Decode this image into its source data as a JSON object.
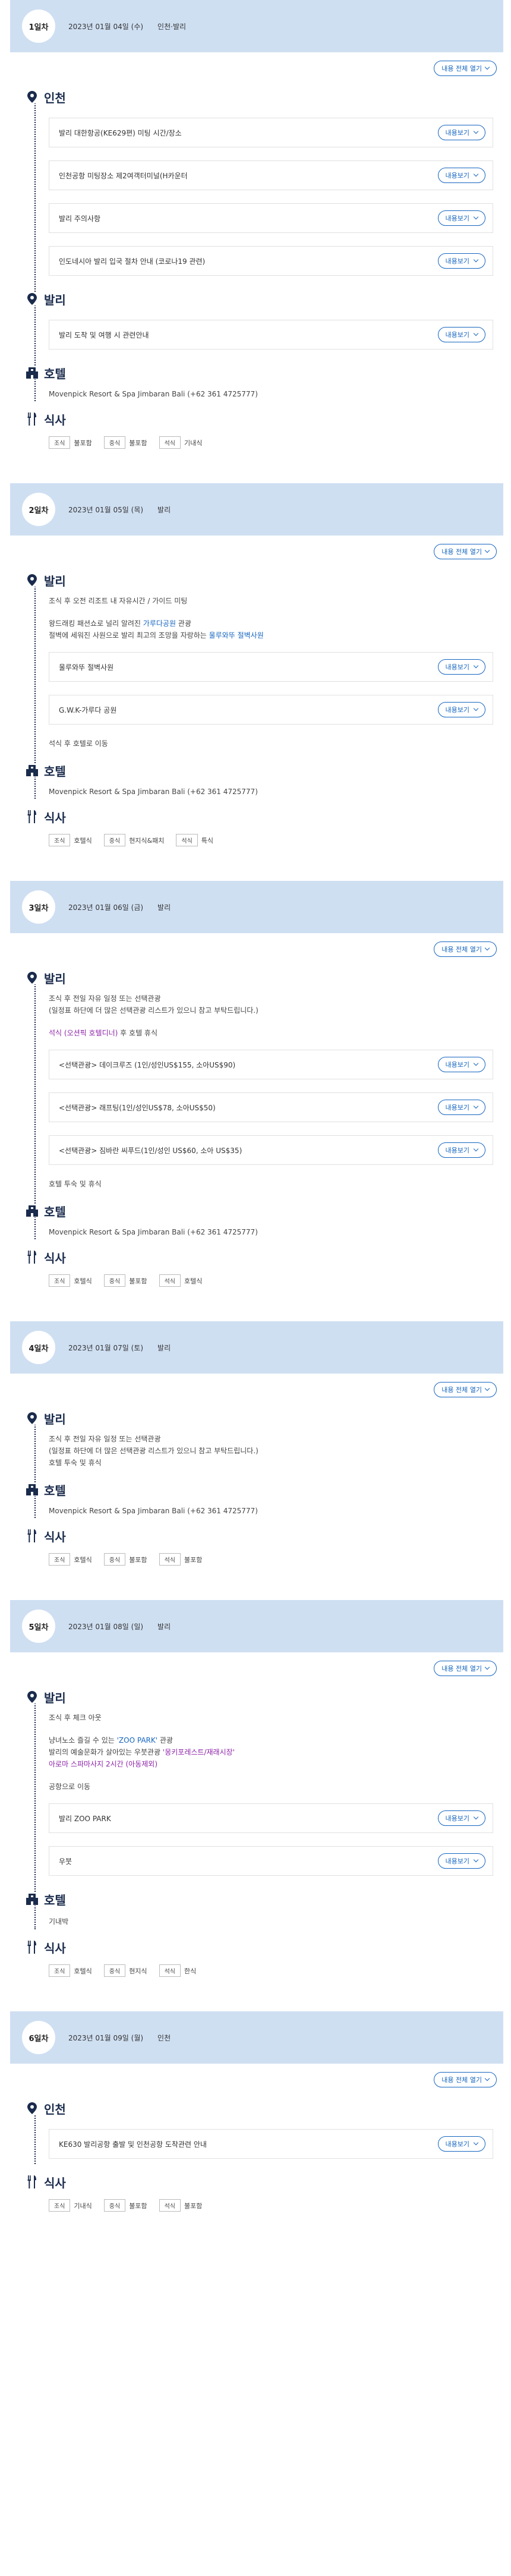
{
  "expand_all_label": "내용 전체 열기",
  "more_label": "내용보기",
  "days": [
    {
      "badge": "1일차",
      "date": "2023년 01월 04일 (수)",
      "place": "인천·발리",
      "incheon_title": "인천",
      "incheon_items": [
        "발리 대한항공(KE629편) 미팅 시간/장소",
        "인천공항 미팅장소 제2여객터미널(H카운터",
        "발리 주의사항",
        "인도네시아 발리 입국 절차 안내 (코로나19 관련)"
      ],
      "bali_title": "발리",
      "bali_items": [
        "발리 도착 및 여행 시 관련안내"
      ],
      "hotel_title": "호텔",
      "hotel": "Movenpick Resort & Spa Jimbaran Bali (+62 361 4725777)",
      "meal_title": "식사",
      "meals": [
        {
          "tag": "조식",
          "val": "불포함"
        },
        {
          "tag": "중식",
          "val": "불포함"
        },
        {
          "tag": "석식",
          "val": "기내식"
        }
      ]
    },
    {
      "badge": "2일차",
      "date": "2023년 01월 05일 (목)",
      "place": "발리",
      "bali_title": "발리",
      "text1": "조식 후 오전 리조트 내 자유시간 / 가이드 미팅",
      "text2a": "왕드래킹 패션쇼로 널리 알려진 ",
      "text2b": "가루다공원",
      "text2c": " 관광",
      "text3a": "절벽에 세워진 사원으로 발리 최고의 조망을 자랑하는 ",
      "text3b": "울루와뚜 절벽사원",
      "bali_items": [
        "울루와뚜 절벽사원",
        "G.W.K-가루다 공원"
      ],
      "text4": "석식 후 호텔로 이동",
      "hotel_title": "호텔",
      "hotel": "Movenpick Resort & Spa Jimbaran Bali (+62 361 4725777)",
      "meal_title": "식사",
      "meals": [
        {
          "tag": "조식",
          "val": "호텔식"
        },
        {
          "tag": "중식",
          "val": "현지식&패치"
        },
        {
          "tag": "석식",
          "val": "특식"
        }
      ]
    },
    {
      "badge": "3일차",
      "date": "2023년 01월 06일 (금)",
      "place": "발리",
      "bali_title": "발리",
      "text1": "조식 후 전일 자유 일정 또는 선택관광",
      "text2": "(일정표 하단에 더 많은 선택관광 리스트가 있으니 참고 부탁드립니다.)",
      "text3a": "석식 (오션픽 호텔디너)",
      "text3b": " 후 호텔 휴식",
      "bali_items": [
        "<선택관광> 데이크루즈 (1인/성인US$155, 소아US$90)",
        "<선택관광> 래프팅(1인/성인US$78, 소아US$50)",
        "<선택관광> 짐바란 씨푸드(1인/성인 US$60, 소아 US$35)"
      ],
      "text4": "호텔 투숙 및 휴식",
      "hotel_title": "호텔",
      "hotel": "Movenpick Resort & Spa Jimbaran Bali (+62 361 4725777)",
      "meal_title": "식사",
      "meals": [
        {
          "tag": "조식",
          "val": "호텔식"
        },
        {
          "tag": "중식",
          "val": "불포함"
        },
        {
          "tag": "석식",
          "val": "호텔식"
        }
      ]
    },
    {
      "badge": "4일차",
      "date": "2023년 01월 07일 (토)",
      "place": "발리",
      "bali_title": "발리",
      "text1": "조식 후 전일 자유 일정 또는 선택관광",
      "text2": "(일정표 하단에 더 많은 선택관광 리스트가 있으니 참고 부탁드립니다.)",
      "text3": "호텔 투숙 및 휴식",
      "hotel_title": "호텔",
      "hotel": "Movenpick Resort & Spa Jimbaran Bali (+62 361 4725777)",
      "meal_title": "식사",
      "meals": [
        {
          "tag": "조식",
          "val": "호텔식"
        },
        {
          "tag": "중식",
          "val": "불포함"
        },
        {
          "tag": "석식",
          "val": "불포함"
        }
      ]
    },
    {
      "badge": "5일차",
      "date": "2023년 01월 08일 (일)",
      "place": "발리",
      "bali_title": "발리",
      "text1": "조식 후 체크 아웃",
      "text2a": "냥녀노소 즐길 수 있는 ",
      "text2b": "'ZOO PARK'",
      "text2c": " 관광",
      "text3a": "발리의 예술문화가 살아있는 우붓관광 ",
      "text3b": "'몽키포레스트/재래시장'",
      "text4": "아로마 스파마사지 2시간 (아동제외)",
      "text5": "공항으로 이동",
      "bali_items": [
        "발리 ZOO PARK",
        "우붓"
      ],
      "hotel_title": "호텔",
      "hotel": "기내박",
      "meal_title": "식사",
      "meals": [
        {
          "tag": "조식",
          "val": "호텔식"
        },
        {
          "tag": "중식",
          "val": "현지식"
        },
        {
          "tag": "석식",
          "val": "한식"
        }
      ]
    },
    {
      "badge": "6일차",
      "date": "2023년 01월 09일 (월)",
      "place": "인천",
      "incheon_title": "인천",
      "incheon_items": [
        "KE630 발리공항 출발 및 인천공항 도착관련 안내"
      ],
      "meal_title": "식사",
      "meals": [
        {
          "tag": "조식",
          "val": "기내식"
        },
        {
          "tag": "중식",
          "val": "불포함"
        },
        {
          "tag": "석식",
          "val": "불포함"
        }
      ]
    }
  ]
}
